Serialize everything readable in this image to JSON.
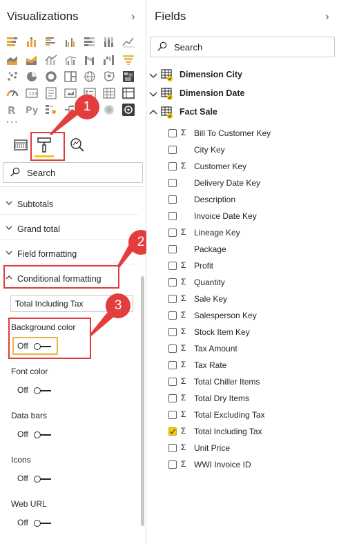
{
  "visualizations": {
    "title": "Visualizations",
    "more_label": "···",
    "search_placeholder": "Search",
    "sections": [
      {
        "label": "Subtotals"
      },
      {
        "label": "Grand total"
      },
      {
        "label": "Field formatting"
      },
      {
        "label": "Conditional formatting"
      }
    ],
    "conditional": {
      "selected_field": "Total Including Tax",
      "properties": [
        {
          "label": "Background color",
          "toggle": "Off"
        },
        {
          "label": "Font color",
          "toggle": "Off"
        },
        {
          "label": "Data bars",
          "toggle": "Off"
        },
        {
          "label": "Icons",
          "toggle": "Off"
        },
        {
          "label": "Web URL",
          "toggle": "Off"
        }
      ]
    },
    "callouts": [
      "1",
      "2",
      "3"
    ]
  },
  "fields": {
    "title": "Fields",
    "search_placeholder": "Search",
    "tables": [
      {
        "name": "Dimension City",
        "expanded": false
      },
      {
        "name": "Dimension Date",
        "expanded": false
      },
      {
        "name": "Fact Sale",
        "expanded": true
      }
    ],
    "fact_sale_fields": [
      {
        "name": "Bill To Customer Key",
        "sigma": true,
        "checked": false
      },
      {
        "name": "City Key",
        "sigma": false,
        "checked": false
      },
      {
        "name": "Customer Key",
        "sigma": true,
        "checked": false
      },
      {
        "name": "Delivery Date Key",
        "sigma": false,
        "checked": false
      },
      {
        "name": "Description",
        "sigma": false,
        "checked": false
      },
      {
        "name": "Invoice Date Key",
        "sigma": false,
        "checked": false
      },
      {
        "name": "Lineage Key",
        "sigma": true,
        "checked": false
      },
      {
        "name": "Package",
        "sigma": false,
        "checked": false
      },
      {
        "name": "Profit",
        "sigma": true,
        "checked": false
      },
      {
        "name": "Quantity",
        "sigma": true,
        "checked": false
      },
      {
        "name": "Sale Key",
        "sigma": true,
        "checked": false
      },
      {
        "name": "Salesperson Key",
        "sigma": true,
        "checked": false
      },
      {
        "name": "Stock Item Key",
        "sigma": true,
        "checked": false
      },
      {
        "name": "Tax Amount",
        "sigma": true,
        "checked": false
      },
      {
        "name": "Tax Rate",
        "sigma": true,
        "checked": false
      },
      {
        "name": "Total Chiller Items",
        "sigma": true,
        "checked": false
      },
      {
        "name": "Total Dry Items",
        "sigma": true,
        "checked": false
      },
      {
        "name": "Total Excluding Tax",
        "sigma": true,
        "checked": false
      },
      {
        "name": "Total Including Tax",
        "sigma": true,
        "checked": true
      },
      {
        "name": "Unit Price",
        "sigma": true,
        "checked": false
      },
      {
        "name": "WWI Invoice ID",
        "sigma": true,
        "checked": false
      }
    ]
  },
  "colors": {
    "accent_yellow": "#f2c811",
    "callout_red": "#e43d3d",
    "highlight_orange": "#e8b545"
  }
}
